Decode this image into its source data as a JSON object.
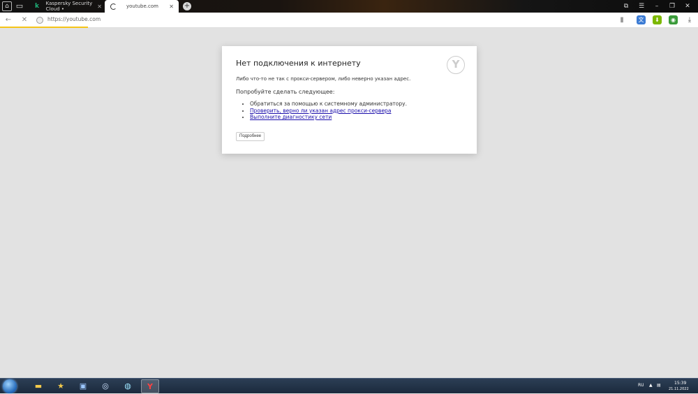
{
  "tabs": [
    {
      "title": "Kaspersky Security Cloud •",
      "favicon": "kaspersky-icon"
    },
    {
      "title": "youtube.com",
      "favicon": "loading-spinner-icon",
      "active": true
    }
  ],
  "address_bar": {
    "url": "https://youtube.com"
  },
  "error": {
    "title": "Нет подключения к интернету",
    "message": "Либо что-то не так с прокси-сервером, либо неверно указан адрес.",
    "try_heading": "Попробуйте сделать следующее:",
    "suggestions": [
      "Обратиться за помощью к системному администратору.",
      "Проверить, верно ли указан адрес прокси-сервера",
      "Выполните диагностику сети"
    ],
    "more_button": "Подробнее"
  },
  "taskbar": {
    "lang": "RU",
    "time": "15:39",
    "date": "21.11.2022"
  },
  "colors": {
    "accent_progress": "#f5c518",
    "link": "#1a0dab",
    "page_bg": "#e2e2e2"
  }
}
